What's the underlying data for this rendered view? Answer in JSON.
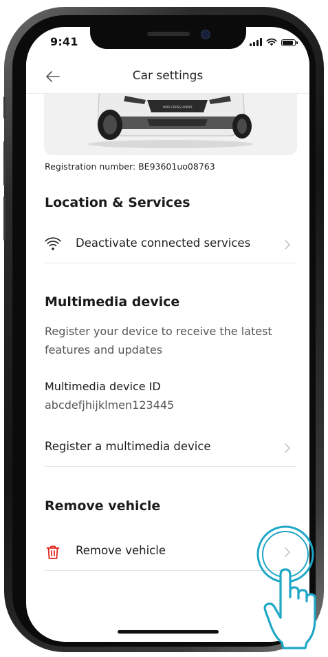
{
  "status_bar": {
    "time": "9:41"
  },
  "header": {
    "title": "Car settings"
  },
  "vehicle": {
    "plate_text": "YARIS CROSS HYBRID",
    "registration": "Registration number: BE93601uo08763"
  },
  "location_services": {
    "title": "Location & Services",
    "items": [
      {
        "label": "Deactivate connected services",
        "icon": "wifi-icon"
      }
    ]
  },
  "multimedia": {
    "title": "Multimedia device",
    "description": "Register your device to receive the latest features and updates",
    "device_id_label": "Multimedia device ID",
    "device_id_value": "abcdefjhijklmen123445",
    "register_label": "Register a multimedia device"
  },
  "remove": {
    "title": "Remove vehicle",
    "item_label": "Remove vehicle",
    "icon": "trash-icon",
    "icon_color": "#e2231a"
  },
  "colors": {
    "accent_touch": "#1ea7c6",
    "divider": "#e4e4e4"
  }
}
